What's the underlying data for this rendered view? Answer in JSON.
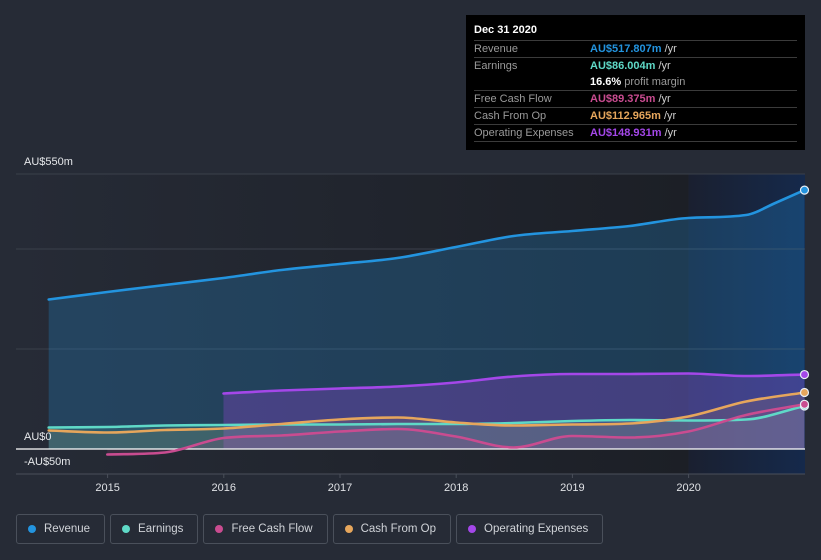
{
  "tooltip": {
    "date": "Dec 31 2020",
    "rows": [
      {
        "label": "Revenue",
        "value": "AU$517.807m",
        "unit": "/yr",
        "color": "#2394df"
      },
      {
        "label": "Earnings",
        "value": "AU$86.004m",
        "unit": "/yr",
        "color": "#5fd9c7"
      },
      {
        "label": "Free Cash Flow",
        "value": "AU$89.375m",
        "unit": "/yr",
        "color": "#c94c90"
      },
      {
        "label": "Cash From Op",
        "value": "AU$112.965m",
        "unit": "/yr",
        "color": "#e6a65c"
      },
      {
        "label": "Operating Expenses",
        "value": "AU$148.931m",
        "unit": "/yr",
        "color": "#a447e9"
      }
    ],
    "profit_margin": {
      "value": "16.6%",
      "label": "profit margin"
    }
  },
  "legend": [
    {
      "label": "Revenue",
      "color": "#2394df"
    },
    {
      "label": "Earnings",
      "color": "#5fd9c7"
    },
    {
      "label": "Free Cash Flow",
      "color": "#c94c90"
    },
    {
      "label": "Cash From Op",
      "color": "#e6a65c"
    },
    {
      "label": "Operating Expenses",
      "color": "#a447e9"
    }
  ],
  "chart_data": {
    "type": "area",
    "title": "",
    "xlabel": "",
    "ylabel": "",
    "units": "AU$ millions per year",
    "x_ticks": [
      "2015",
      "2016",
      "2017",
      "2018",
      "2019",
      "2020"
    ],
    "y_axis": {
      "min": -50,
      "max": 550,
      "gridlines": [
        200,
        400,
        550
      ],
      "tick_labels": [
        {
          "value": 550,
          "label": "AU$550m"
        },
        {
          "value": 0,
          "label": "AU$0"
        },
        {
          "value": -50,
          "label": "-AU$50m"
        }
      ]
    },
    "highlight_range": [
      "2020-01-01",
      "2020-12-31"
    ],
    "legend_position": "bottom",
    "series": [
      {
        "name": "Revenue",
        "color": "#2394df",
        "x": [
          "2014-06-30",
          "2014-12-31",
          "2015-06-30",
          "2015-12-31",
          "2016-06-30",
          "2016-12-31",
          "2017-06-30",
          "2017-12-31",
          "2018-06-30",
          "2018-12-31",
          "2019-06-30",
          "2019-12-31",
          "2020-06-30",
          "2020-09-30",
          "2020-12-31"
        ],
        "values": [
          299,
          314,
          328,
          342,
          358,
          370,
          382,
          404,
          426,
          436,
          446,
          462,
          468,
          492,
          517.8
        ]
      },
      {
        "name": "Operating Expenses",
        "color": "#a447e9",
        "x": [
          "2015-12-31",
          "2016-06-30",
          "2016-12-31",
          "2017-06-30",
          "2017-12-31",
          "2018-06-30",
          "2018-12-31",
          "2019-06-30",
          "2019-12-31",
          "2020-06-30",
          "2020-12-31"
        ],
        "values": [
          111,
          117,
          121,
          125,
          133,
          145,
          150,
          150,
          151,
          146,
          148.9
        ]
      },
      {
        "name": "Cash From Op",
        "color": "#e6a65c",
        "x": [
          "2014-06-30",
          "2014-12-31",
          "2015-06-30",
          "2015-12-31",
          "2016-06-30",
          "2016-12-31",
          "2017-06-30",
          "2017-12-31",
          "2018-06-30",
          "2018-12-31",
          "2019-06-30",
          "2019-12-31",
          "2020-06-30",
          "2020-12-31"
        ],
        "values": [
          37,
          33,
          38,
          41,
          50,
          59,
          63,
          53,
          47,
          49,
          51,
          65,
          95,
          113.0
        ]
      },
      {
        "name": "Earnings",
        "color": "#5fd9c7",
        "x": [
          "2014-06-30",
          "2014-12-31",
          "2015-06-30",
          "2015-12-31",
          "2016-06-30",
          "2016-12-31",
          "2017-06-30",
          "2017-12-31",
          "2018-06-30",
          "2018-12-31",
          "2019-06-30",
          "2019-12-31",
          "2020-06-30",
          "2020-12-31"
        ],
        "values": [
          43,
          44,
          47,
          48,
          49,
          49,
          50,
          50,
          52,
          56,
          58,
          57,
          59,
          86.0
        ]
      },
      {
        "name": "Free Cash Flow",
        "color": "#c94c90",
        "x": [
          "2014-12-31",
          "2015-06-30",
          "2015-12-31",
          "2016-06-30",
          "2016-12-31",
          "2017-06-30",
          "2017-12-31",
          "2018-06-30",
          "2018-12-31",
          "2019-06-30",
          "2019-12-31",
          "2020-06-30",
          "2020-12-31"
        ],
        "values": [
          -11,
          -7,
          22,
          27,
          35,
          40,
          25,
          3,
          26,
          23,
          35,
          68,
          89.4
        ]
      }
    ]
  }
}
